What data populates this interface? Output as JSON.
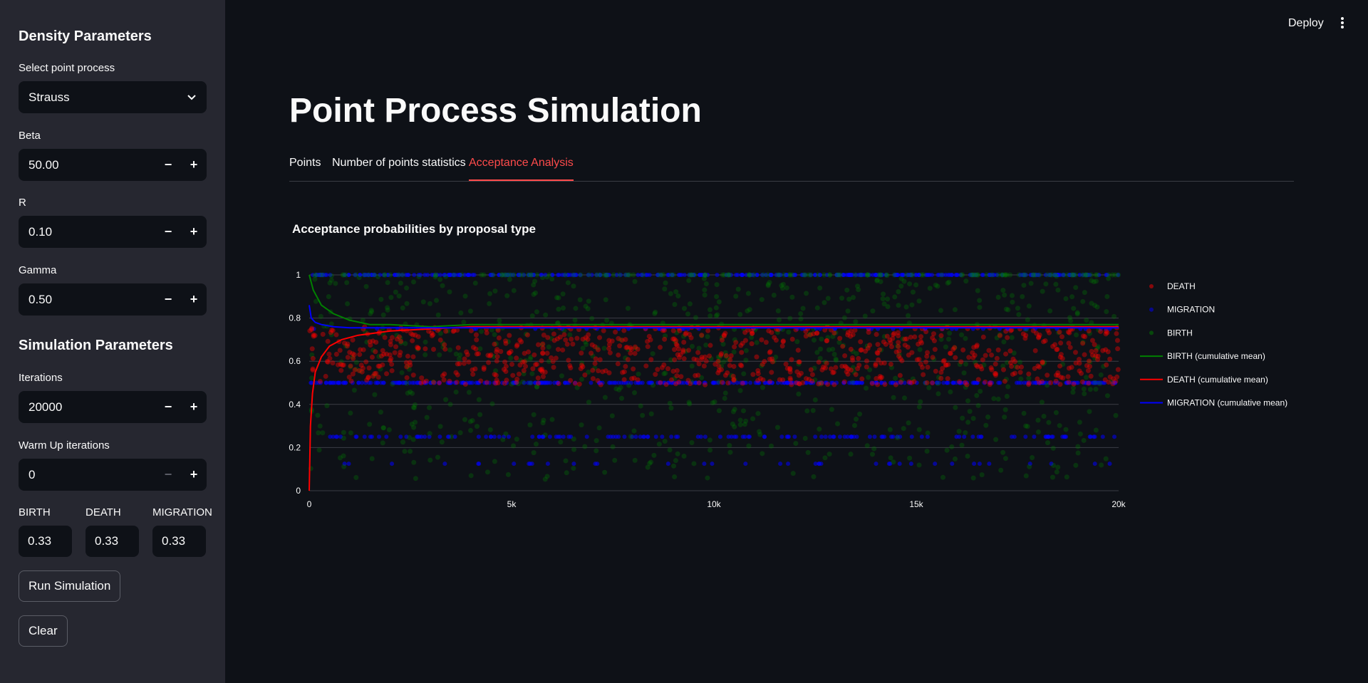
{
  "sidebar": {
    "density_title": "Density Parameters",
    "process_label": "Select point process",
    "process_value": "Strauss",
    "beta_label": "Beta",
    "beta_value": "50.00",
    "r_label": "R",
    "r_value": "0.10",
    "gamma_label": "Gamma",
    "gamma_value": "0.50",
    "sim_title": "Simulation Parameters",
    "iterations_label": "Iterations",
    "iterations_value": "20000",
    "warmup_label": "Warm Up iterations",
    "warmup_value": "0",
    "birth_label": "BIRTH",
    "birth_value": "0.33",
    "death_label": "DEATH",
    "death_value": "0.33",
    "migration_label": "MIGRATION",
    "migration_value": "0.33",
    "run_label": "Run Simulation",
    "clear_label": "Clear",
    "minus": "−",
    "plus": "+"
  },
  "header": {
    "deploy_label": "Deploy",
    "menu_icon": "kebab-menu-icon"
  },
  "main": {
    "title": "Point Process Simulation",
    "tabs": [
      {
        "label": "Points",
        "active": false
      },
      {
        "label": "Number of points statistics",
        "active": false
      },
      {
        "label": "Acceptance Analysis",
        "active": true
      }
    ]
  },
  "colors": {
    "accent": "#ff4b4b",
    "birth": "#008000",
    "death": "#ff0000",
    "migration": "#0000ff"
  },
  "chart_data": {
    "type": "scatter",
    "title": "Acceptance probabilities by proposal type",
    "xlim": [
      0,
      20000
    ],
    "ylim": [
      0,
      1
    ],
    "x_ticks": [
      0,
      5000,
      10000,
      15000,
      20000
    ],
    "x_tick_labels": [
      "0",
      "5k",
      "10k",
      "15k",
      "20k"
    ],
    "y_ticks": [
      0,
      0.2,
      0.4,
      0.6,
      0.8,
      1
    ],
    "y_tick_labels": [
      "0",
      "0.2",
      "0.4",
      "0.6",
      "0.8",
      "1"
    ],
    "grid": true,
    "legend_position": "right",
    "series": [
      {
        "name": "DEATH",
        "kind": "markers",
        "color": "#ff0000",
        "typical_range": [
          0.4,
          0.85
        ]
      },
      {
        "name": "MIGRATION",
        "kind": "markers",
        "color": "#0000ff",
        "levels": [
          1.0,
          0.75,
          0.5,
          0.25,
          0.125
        ]
      },
      {
        "name": "BIRTH",
        "kind": "markers",
        "color": "#008000",
        "typical_range": [
          0.05,
          1.0
        ]
      },
      {
        "name": "BIRTH (cumulative mean)",
        "kind": "line",
        "color": "#008000",
        "x": [
          0,
          100,
          300,
          600,
          1000,
          1500,
          2000,
          3000,
          4000,
          5000,
          8000,
          12000,
          16000,
          20000
        ],
        "y": [
          1.0,
          0.93,
          0.86,
          0.82,
          0.79,
          0.77,
          0.77,
          0.76,
          0.77,
          0.77,
          0.77,
          0.77,
          0.77,
          0.77
        ]
      },
      {
        "name": "DEATH (cumulative mean)",
        "kind": "line",
        "color": "#ff0000",
        "x": [
          0,
          30,
          80,
          150,
          300,
          500,
          800,
          1200,
          2000,
          3000,
          4000,
          5000,
          8000,
          12000,
          16000,
          20000
        ],
        "y": [
          0.0,
          0.3,
          0.45,
          0.55,
          0.62,
          0.67,
          0.7,
          0.72,
          0.74,
          0.75,
          0.76,
          0.76,
          0.76,
          0.76,
          0.76,
          0.76
        ]
      },
      {
        "name": "MIGRATION (cumulative mean)",
        "kind": "line",
        "color": "#0000ff",
        "x": [
          0,
          50,
          150,
          300,
          600,
          1000,
          2000,
          3000,
          5000,
          10000,
          15000,
          20000
        ],
        "y": [
          0.86,
          0.8,
          0.78,
          0.77,
          0.76,
          0.755,
          0.755,
          0.755,
          0.755,
          0.755,
          0.755,
          0.755
        ]
      }
    ]
  }
}
